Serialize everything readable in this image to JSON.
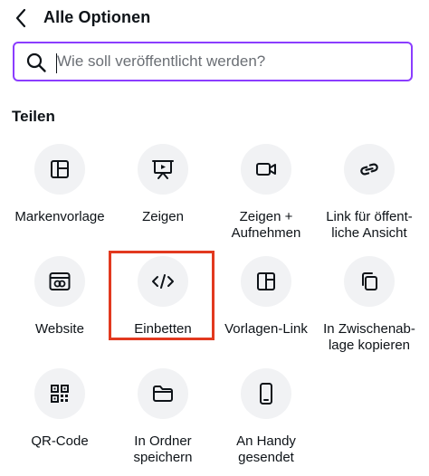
{
  "header": {
    "title": "Alle Optionen",
    "back_icon": "chevron-left-icon"
  },
  "search": {
    "placeholder": "Wie soll veröffentlicht werden?",
    "value": "",
    "icon": "search-icon",
    "accent_color": "#8b3dff"
  },
  "section": {
    "title": "Teilen"
  },
  "highlight_color": "#e2391f",
  "options": [
    {
      "label": "Markenvorlage",
      "icon": "brand-template-icon"
    },
    {
      "label": "Zeigen",
      "icon": "present-icon"
    },
    {
      "label": "Zeigen +\nAufnehmen",
      "icon": "video-camera-icon"
    },
    {
      "label": "Link für öffent-\nliche Ansicht",
      "icon": "link-icon"
    },
    {
      "label": "Website",
      "icon": "website-icon"
    },
    {
      "label": "Einbetten",
      "icon": "embed-code-icon",
      "highlighted": true
    },
    {
      "label": "Vorlagen-Link",
      "icon": "template-link-icon"
    },
    {
      "label": "In Zwischenab-\nlage kopieren",
      "icon": "copy-icon"
    },
    {
      "label": "QR-Code",
      "icon": "qr-code-icon"
    },
    {
      "label": "In Ordner\nspeichern",
      "icon": "folder-icon"
    },
    {
      "label": "An Handy\ngesendet",
      "icon": "phone-icon"
    }
  ]
}
